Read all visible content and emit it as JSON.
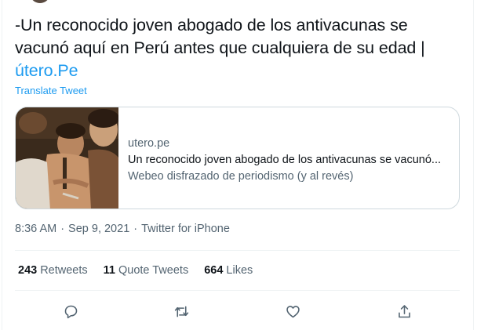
{
  "tweet": {
    "text": "-Un reconocido joven abogado de los antivacunas se vacunó aquí en Perú antes que cualquiera de su edad | ",
    "link_text": "útero.Pe",
    "translate_label": "Translate Tweet"
  },
  "card": {
    "domain": "utero.pe",
    "title": "Un reconocido joven abogado de los antivacunas se vacunó...",
    "description": "Webeo disfrazado de periodismo (y al revés)"
  },
  "meta": {
    "time": "8:36 AM",
    "separator1": "·",
    "date": "Sep 9, 2021",
    "separator2": "·",
    "source": "Twitter for iPhone"
  },
  "stats": {
    "retweets_count": "243",
    "retweets_label": "Retweets",
    "quotes_count": "11",
    "quotes_label": "Quote Tweets",
    "likes_count": "664",
    "likes_label": "Likes"
  },
  "actions": {
    "reply_icon": "reply-icon",
    "retweet_icon": "retweet-icon",
    "like_icon": "heart-icon",
    "share_icon": "share-icon"
  },
  "colors": {
    "link": "#1d9bf0",
    "text": "#0f1419",
    "secondary": "#536471",
    "border": "#cfd9de",
    "divider": "#eff3f4"
  }
}
